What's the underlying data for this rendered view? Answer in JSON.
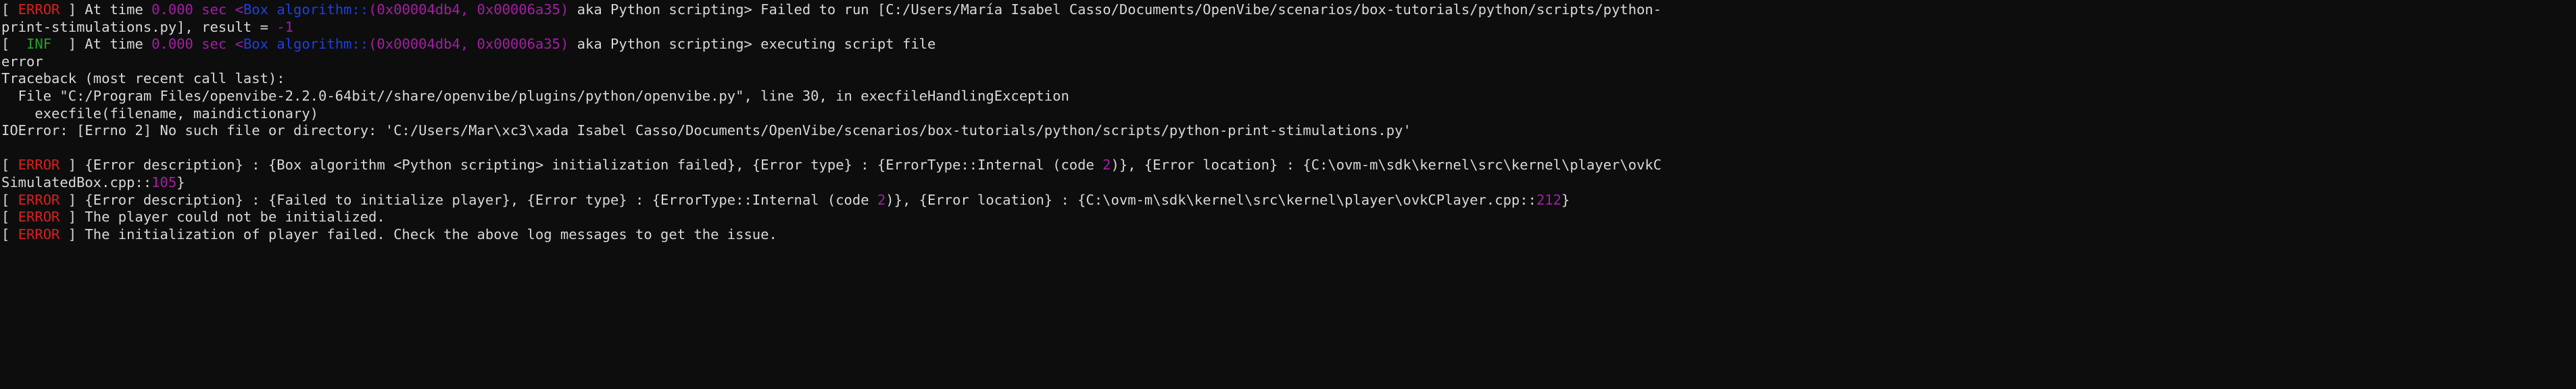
{
  "console": {
    "background_color": "#0d0d0d",
    "default_text_color": "#d8d8d8",
    "colors": {
      "error": "#d72020",
      "info": "#26a128",
      "magenta": "#a21fa2",
      "blue": "#1f3fe0",
      "plain": "#d8d8d8"
    },
    "lines": [
      {
        "id": "line-1",
        "tokens": [
          {
            "text": "[ ",
            "color": "plain"
          },
          {
            "text": "ERROR",
            "color": "error"
          },
          {
            "text": " ] At time ",
            "color": "plain"
          },
          {
            "text": "0.000",
            "color": "magenta"
          },
          {
            "text": " sec <",
            "color": "magenta"
          },
          {
            "text": "Box algorithm",
            "color": "blue"
          },
          {
            "text": "::",
            "color": "blue"
          },
          {
            "text": "(0x00004db4, 0x00006a35)",
            "color": "magenta"
          },
          {
            "text": " aka Python scripting> Failed to run [C:/Users/María Isabel Casso/Documents/OpenVibe/scenarios/box-tutorials/python/scripts/python-",
            "color": "plain"
          }
        ]
      },
      {
        "id": "line-2",
        "tokens": [
          {
            "text": "print-stimulations.py], result = ",
            "color": "plain"
          },
          {
            "text": "-1",
            "color": "magenta"
          }
        ]
      },
      {
        "id": "line-3",
        "tokens": [
          {
            "text": "[  ",
            "color": "plain"
          },
          {
            "text": "INF",
            "color": "info"
          },
          {
            "text": "  ] At time ",
            "color": "plain"
          },
          {
            "text": "0.000",
            "color": "magenta"
          },
          {
            "text": " sec <",
            "color": "magenta"
          },
          {
            "text": "Box algorithm",
            "color": "blue"
          },
          {
            "text": "::",
            "color": "blue"
          },
          {
            "text": "(0x00004db4, 0x00006a35)",
            "color": "magenta"
          },
          {
            "text": " aka Python scripting> executing script file",
            "color": "plain"
          }
        ]
      },
      {
        "id": "line-4",
        "tokens": [
          {
            "text": "error",
            "color": "plain"
          }
        ]
      },
      {
        "id": "line-5",
        "tokens": [
          {
            "text": "Traceback (most recent call last):",
            "color": "plain"
          }
        ]
      },
      {
        "id": "line-6",
        "tokens": [
          {
            "text": "  File \"C:/Program Files/openvibe-2.2.0-64bit//share/openvibe/plugins/python/openvibe.py\", line 30, in execfileHandlingException",
            "color": "plain"
          }
        ]
      },
      {
        "id": "line-7",
        "tokens": [
          {
            "text": "    execfile(filename, maindictionary)",
            "color": "plain"
          }
        ]
      },
      {
        "id": "line-8",
        "tokens": [
          {
            "text": "IOError: [Errno 2] No such file or directory: 'C:/Users/Mar\\xc3\\xada Isabel Casso/Documents/OpenVibe/scenarios/box-tutorials/python/scripts/python-print-stimulations.py'",
            "color": "plain"
          }
        ]
      },
      {
        "id": "line-9",
        "tokens": [
          {
            "text": "",
            "color": "plain"
          }
        ]
      },
      {
        "id": "line-10",
        "tokens": [
          {
            "text": "[ ",
            "color": "plain"
          },
          {
            "text": "ERROR",
            "color": "error"
          },
          {
            "text": " ] {Error description} : {Box algorithm <Python scripting> initialization failed}, {Error type} : {ErrorType::Internal (code ",
            "color": "plain"
          },
          {
            "text": "2",
            "color": "magenta"
          },
          {
            "text": ")}, {Error location} : {C:\\ovm-m\\sdk\\kernel\\src\\kernel\\player\\ovkC",
            "color": "plain"
          }
        ]
      },
      {
        "id": "line-11",
        "tokens": [
          {
            "text": "SimulatedBox.cpp::",
            "color": "plain"
          },
          {
            "text": "105",
            "color": "magenta"
          },
          {
            "text": "}",
            "color": "plain"
          }
        ]
      },
      {
        "id": "line-12",
        "tokens": [
          {
            "text": "[ ",
            "color": "plain"
          },
          {
            "text": "ERROR",
            "color": "error"
          },
          {
            "text": " ] {Error description} : {Failed to initialize player}, {Error type} : {ErrorType::Internal (code ",
            "color": "plain"
          },
          {
            "text": "2",
            "color": "magenta"
          },
          {
            "text": ")}, {Error location} : {C:\\ovm-m\\sdk\\kernel\\src\\kernel\\player\\ovkCPlayer.cpp::",
            "color": "plain"
          },
          {
            "text": "212",
            "color": "magenta"
          },
          {
            "text": "}",
            "color": "plain"
          }
        ]
      },
      {
        "id": "line-13",
        "tokens": [
          {
            "text": "[ ",
            "color": "plain"
          },
          {
            "text": "ERROR",
            "color": "error"
          },
          {
            "text": " ] The player could not be initialized.",
            "color": "plain"
          }
        ]
      },
      {
        "id": "line-14",
        "tokens": [
          {
            "text": "[ ",
            "color": "plain"
          },
          {
            "text": "ERROR",
            "color": "error"
          },
          {
            "text": " ] The initialization of player failed. Check the above log messages to get the issue.",
            "color": "plain"
          }
        ]
      }
    ]
  }
}
